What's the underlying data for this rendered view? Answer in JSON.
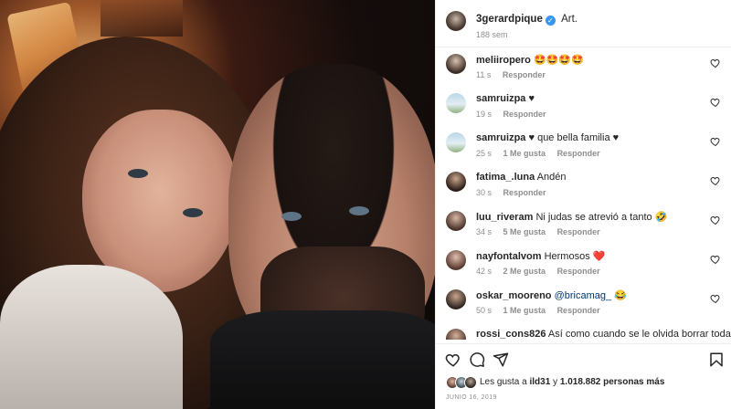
{
  "post": {
    "author": "3gerardpique",
    "caption": "Art.",
    "time_ago": "188 sem",
    "photo_icon": "post-photo"
  },
  "comments": [
    {
      "user": "meliiropero",
      "text": "🤩🤩🤩🤩",
      "time": "11 s",
      "likes": "",
      "reply": "Responder"
    },
    {
      "user": "samruizpa",
      "text": "♥",
      "time": "19 s",
      "likes": "",
      "reply": "Responder"
    },
    {
      "user": "samruizpa",
      "text": "♥ que bella familia ♥",
      "time": "25 s",
      "likes": "1 Me gusta",
      "reply": "Responder"
    },
    {
      "user": "fatima_.luna",
      "text": "Andén",
      "time": "30 s",
      "likes": "",
      "reply": "Responder"
    },
    {
      "user": "luu_riveram",
      "text": "Ni judas se atrevió a tanto 🤣",
      "time": "34 s",
      "likes": "5 Me gusta",
      "reply": "Responder"
    },
    {
      "user": "nayfontalvom",
      "text": "Hermosos ❤️",
      "time": "42 s",
      "likes": "2 Me gusta",
      "reply": "Responder"
    },
    {
      "user": "oskar_mooreno",
      "text": "@bricamag_ 😂",
      "time": "50 s",
      "likes": "1 Me gusta",
      "reply": "Responder"
    },
    {
      "user": "rossi_cons826",
      "text": "Así como cuando se le olvida borrar todas las",
      "time": "",
      "likes": "",
      "reply": ""
    }
  ],
  "likes": {
    "prefix": "Les gusta a",
    "user": "ild31",
    "joiner": "y",
    "count": "1.018.882 personas más"
  },
  "date": "JUNIO 16, 2019",
  "icons": {
    "like": "heart-icon",
    "comment": "comment-icon",
    "share": "send-icon",
    "save": "bookmark-icon"
  },
  "colors": {
    "verified": "#3897f0",
    "mention": "#00376b",
    "muted": "#8e8e8e"
  }
}
